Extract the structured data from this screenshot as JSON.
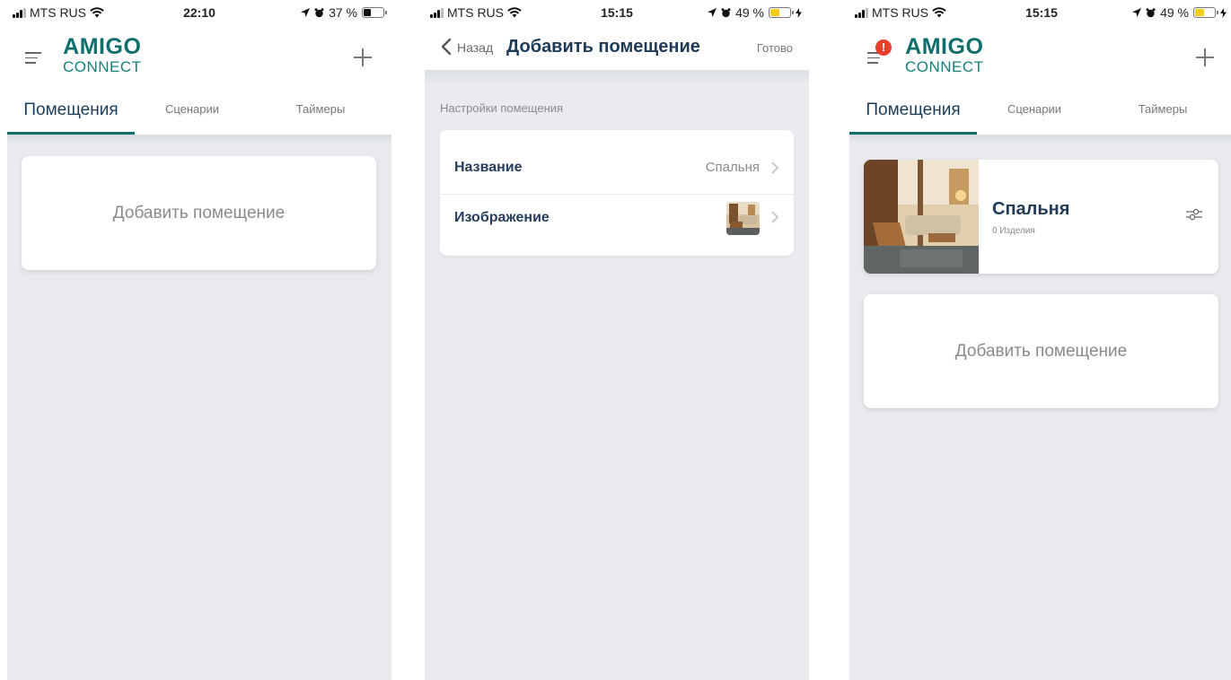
{
  "screens": [
    {
      "status": {
        "carrier": "MTS RUS",
        "time": "22:10",
        "battery": "37 %",
        "battery_level": 0.37,
        "battery_color": "#111111"
      },
      "logo": {
        "line1": "AMIGO",
        "line2": "CONNECT"
      },
      "tabs": [
        "Помещения",
        "Сценарии",
        "Таймеры"
      ],
      "active_tab": 0,
      "add_room_card": "Добавить помещение"
    },
    {
      "status": {
        "carrier": "MTS RUS",
        "time": "15:15",
        "battery": "49 %",
        "battery_level": 0.49,
        "battery_color": "#f5cc1c",
        "charging": true
      },
      "nav": {
        "back_label": "Назад",
        "title": "Добавить помещение",
        "done_label": "Готово"
      },
      "section_label": "Настройки помещения",
      "rows": [
        {
          "label": "Название",
          "value": "Спальня"
        },
        {
          "label": "Изображение",
          "value_icon": "room-photo-thumbnail"
        }
      ]
    },
    {
      "status": {
        "carrier": "MTS RUS",
        "time": "15:15",
        "battery": "49 %",
        "battery_level": 0.49,
        "battery_color": "#f5cc1c",
        "charging": true
      },
      "logo": {
        "line1": "AMIGO",
        "line2": "CONNECT"
      },
      "notification_badge": "!",
      "tabs": [
        "Помещения",
        "Сценарии",
        "Таймеры"
      ],
      "active_tab": 0,
      "room": {
        "name": "Спальня",
        "items": "0 Изделия"
      },
      "add_room_card": "Добавить помещение"
    }
  ],
  "colors": {
    "brand_teal": "#0f6f6c",
    "navy_text": "#1e3a56",
    "background": "#e8eaee",
    "badge_red": "#e6402c"
  },
  "icons": [
    "menu-icon",
    "plus-icon",
    "back-chevron-icon",
    "chevron-right-icon",
    "sliders-icon",
    "wifi-icon",
    "location-arrow-icon",
    "alarm-icon",
    "battery-icon",
    "charging-bolt-icon"
  ]
}
